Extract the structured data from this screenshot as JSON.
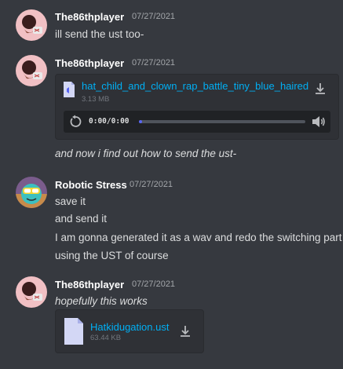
{
  "messages": [
    {
      "author": "The86thplayer",
      "timestamp": "07/27/2021",
      "lines": [
        "ill send the ust too-"
      ]
    },
    {
      "author": "The86thplayer",
      "timestamp": "07/27/2021",
      "attachment": {
        "type": "audio",
        "filename": "hat_child_and_clown_rap_battle_tiny_blue_haired",
        "size": "3.13 MB",
        "current_time": "0:00",
        "duration": "0:00",
        "separator": "/",
        "progress": 0.02
      },
      "lines": [
        "and now i find out how to send the ust-"
      ]
    },
    {
      "author": "Robotic Stress",
      "timestamp": "07/27/2021",
      "lines": [
        "save it",
        "and send it",
        "I am gonna generated it as a wav and redo the switching part cuz t",
        "using the UST of course"
      ]
    },
    {
      "author": "The86thplayer",
      "timestamp": "07/27/2021",
      "lines": [
        "hopefully this works"
      ],
      "attachment": {
        "type": "file",
        "filename": "Hatkidugation.ust",
        "size": "63.44 KB"
      }
    }
  ],
  "colors": {
    "background": "#36393f",
    "link": "#00aff4",
    "accent": "#5865f2"
  }
}
